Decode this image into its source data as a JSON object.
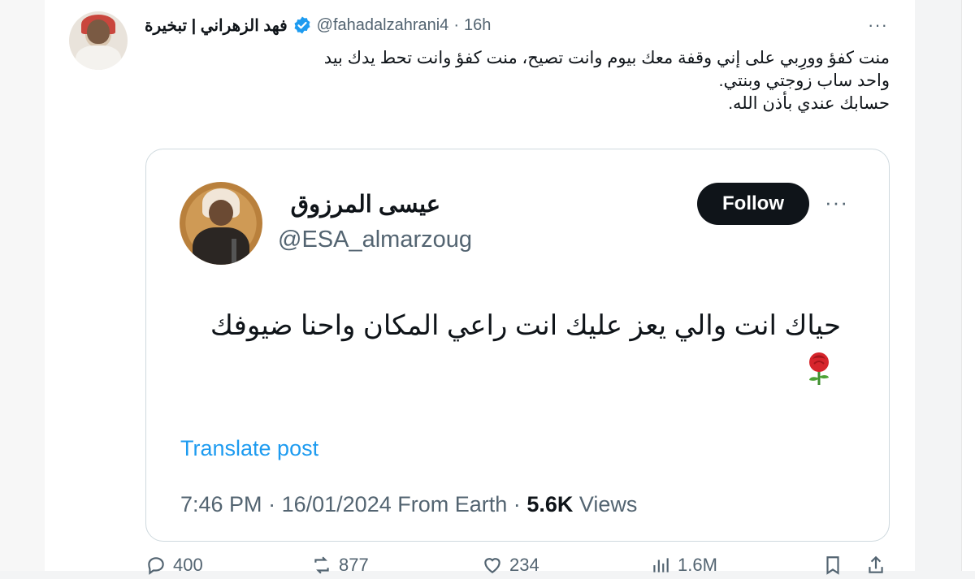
{
  "tweet": {
    "display_name": "فهد الزهراني | تبخيرة",
    "handle": "@fahadalzahrani4",
    "separator": "·",
    "time_ago": "16h",
    "more_label": "···",
    "text_lines": [
      "منت كفؤ وورِبي على إني وقفة معك بيوم وانت تصيح، منت كفؤ وانت تحط يدك بيد",
      "واحد ساب زوجتي وبنتي.",
      "حسابك عندي بأذن الله."
    ]
  },
  "quoted": {
    "display_name": "عيسى المرزوق",
    "handle": "@ESA_almarzoug",
    "follow_label": "Follow",
    "more_label": "···",
    "text": "حياك انت والي يعز عليك انت راعي المكان واحنا ضيوفك",
    "translate_label": "Translate post",
    "time": "7:46 PM",
    "date": "16/01/2024",
    "source": "From Earth",
    "views_count": "5.6K",
    "views_label": "Views",
    "dot": "·"
  },
  "actions": {
    "replies": "400",
    "reposts": "877",
    "likes": "234",
    "views": "1.6M"
  },
  "colors": {
    "link": "#1d9bf0",
    "verified": "#1d9bf0",
    "muted": "#536471",
    "text": "#0f1419"
  }
}
